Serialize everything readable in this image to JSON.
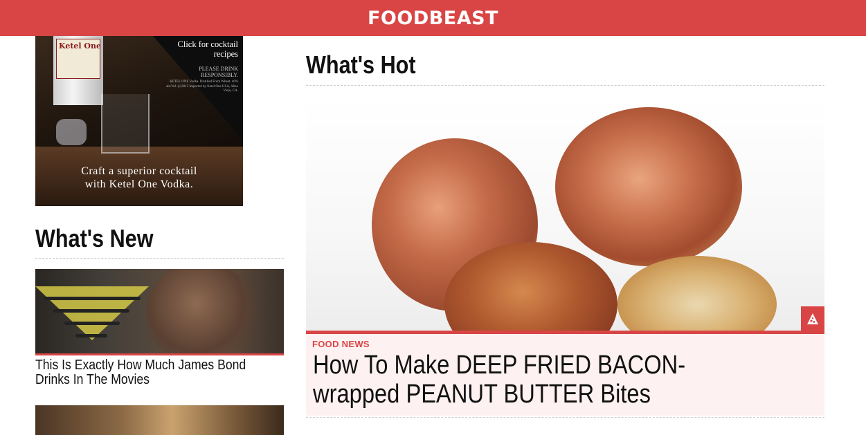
{
  "header": {
    "logo": "FOODBEAST",
    "accent_color": "#d94545"
  },
  "ad": {
    "brand": "Ketel One",
    "cta": "Click for cocktail recipes",
    "warning": "PLEASE DRINK RESPONSIBLY.",
    "fine_print": "KETEL ONE Vodka. Distilled From Wheat. 40% alc/Vol. (c)2015 Imported by Ketel One USA, Aliso Viejo, CA.",
    "tagline_1": "Craft a superior cocktail",
    "tagline_2": "with Ketel One Vodka."
  },
  "whats_new": {
    "title": "What's New",
    "items": [
      {
        "title": "This Is Exactly How Much James Bond Drinks In The Movies"
      }
    ]
  },
  "whats_hot": {
    "title": "What's Hot",
    "featured": {
      "category": "FOOD NEWS",
      "title": "How To Make DEEP FRIED BACON-wrapped PEANUT BUTTER Bites",
      "badge_icon": "pizza-icon"
    }
  }
}
